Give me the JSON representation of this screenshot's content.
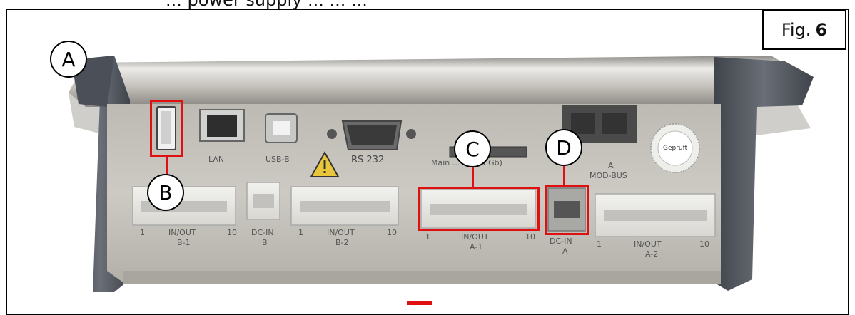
{
  "top_text": "... power supply ... ... ...",
  "figure": {
    "label_prefix": "Fig.",
    "label_number": "6"
  },
  "callouts": {
    "a": "A",
    "b": "B",
    "c": "C",
    "d": "D"
  },
  "device_labels": {
    "lan": "LAN",
    "usb_b": "USB-B",
    "rs232": "RS 232",
    "main_card": "Main ... ard (4 Gb)",
    "modbus_a": "A",
    "modbus": "MOD-BUS",
    "gepruft": "Geprüft",
    "inout_b1_start": "1",
    "inout_b1": "IN/OUT",
    "inout_b1_end": "10",
    "inout_b1_name": "B-1",
    "dcin_b": "DC-IN",
    "dcin_b_name": "B",
    "inout_b2_start": "1",
    "inout_b2": "IN/OUT",
    "inout_b2_end": "10",
    "inout_b2_name": "B-2",
    "inout_a1_start": "1",
    "inout_a1": "IN/OUT",
    "inout_a1_end": "10",
    "inout_a1_name": "A-1",
    "dcin_a": "DC-IN",
    "dcin_a_name": "A",
    "inout_a2_start": "1",
    "inout_a2": "IN/OUT",
    "inout_a2_end": "10",
    "inout_a2_name": "A-2"
  },
  "colors": {
    "highlight": "#e01010",
    "housing": "#c9c6c0",
    "end_cap": "#5a5e66"
  }
}
